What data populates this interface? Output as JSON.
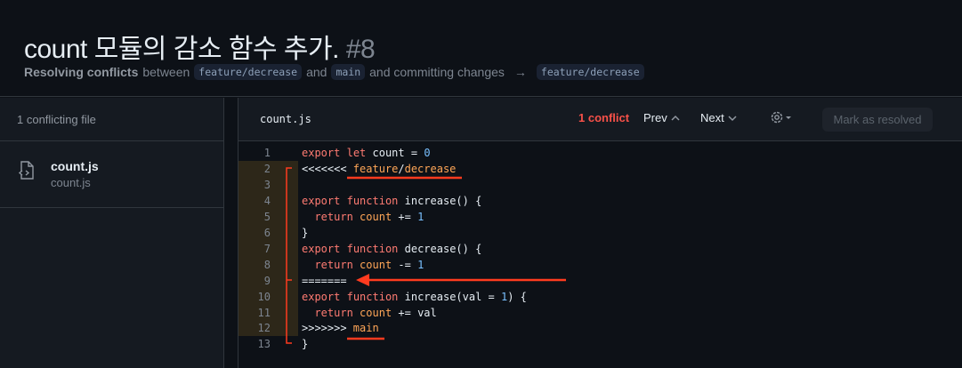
{
  "header": {
    "title": "count 모듈의 감소 함수 추가.",
    "number": "#8",
    "subtitle": {
      "bold": "Resolving conflicts",
      "t1": "between",
      "branch1": "feature/decrease",
      "t2": "and",
      "branch2": "main",
      "t3": "and committing changes",
      "arrow": "→",
      "target": "feature/decrease"
    }
  },
  "sidebar": {
    "heading": "1 conflicting file",
    "files": [
      {
        "name": "count.js",
        "path": "count.js",
        "icon": "file-code-icon"
      }
    ]
  },
  "toolbar": {
    "filename": "count.js",
    "conflicts": "1 conflict",
    "prev": "Prev",
    "next": "Next",
    "settings_icon": "gear-icon",
    "mark_resolved": "Mark as resolved"
  },
  "colors": {
    "conflict": "#f85149",
    "keyword": "#ff7b72",
    "variable": "#ffa657",
    "number": "#79c0ff",
    "annotation": "#ff3b1f"
  },
  "code": [
    {
      "n": "1",
      "conflict": false,
      "t": [
        [
          "export",
          "kw"
        ],
        [
          " ",
          "pl"
        ],
        [
          "let",
          "kw"
        ],
        [
          " count = ",
          "pl"
        ],
        [
          "0",
          "nm"
        ]
      ]
    },
    {
      "n": "2",
      "conflict": true,
      "t": [
        [
          "<<<<<<< ",
          "pl"
        ],
        [
          "feature",
          "br"
        ],
        [
          "/",
          "pl"
        ],
        [
          "decrease",
          "br"
        ]
      ]
    },
    {
      "n": "3",
      "conflict": true,
      "t": []
    },
    {
      "n": "4",
      "conflict": true,
      "t": [
        [
          "export",
          "kw"
        ],
        [
          " ",
          "pl"
        ],
        [
          "function",
          "kw"
        ],
        [
          " increase() {",
          "pl"
        ]
      ]
    },
    {
      "n": "5",
      "conflict": true,
      "t": [
        [
          "  ",
          "pl"
        ],
        [
          "return",
          "kw"
        ],
        [
          " ",
          "pl"
        ],
        [
          "count",
          "var"
        ],
        [
          " += ",
          "pl"
        ],
        [
          "1",
          "nm"
        ]
      ]
    },
    {
      "n": "6",
      "conflict": true,
      "t": [
        [
          "}",
          "pl"
        ]
      ]
    },
    {
      "n": "7",
      "conflict": true,
      "t": [
        [
          "export",
          "kw"
        ],
        [
          " ",
          "pl"
        ],
        [
          "function",
          "kw"
        ],
        [
          " decrease() {",
          "pl"
        ]
      ]
    },
    {
      "n": "8",
      "conflict": true,
      "t": [
        [
          "  ",
          "pl"
        ],
        [
          "return",
          "kw"
        ],
        [
          " ",
          "pl"
        ],
        [
          "count",
          "var"
        ],
        [
          " -= ",
          "pl"
        ],
        [
          "1",
          "nm"
        ]
      ]
    },
    {
      "n": "9",
      "conflict": true,
      "t": [
        [
          "=======",
          "pl"
        ]
      ]
    },
    {
      "n": "10",
      "conflict": true,
      "t": [
        [
          "export",
          "kw"
        ],
        [
          " ",
          "pl"
        ],
        [
          "function",
          "kw"
        ],
        [
          " increase(val = ",
          "pl"
        ],
        [
          "1",
          "nm"
        ],
        [
          ") {",
          "pl"
        ]
      ]
    },
    {
      "n": "11",
      "conflict": true,
      "t": [
        [
          "  ",
          "pl"
        ],
        [
          "return",
          "kw"
        ],
        [
          " ",
          "pl"
        ],
        [
          "count",
          "var"
        ],
        [
          " += val",
          "pl"
        ]
      ]
    },
    {
      "n": "12",
      "conflict": true,
      "t": [
        [
          ">>>>>>> ",
          "pl"
        ],
        [
          "main",
          "br"
        ]
      ]
    },
    {
      "n": "13",
      "conflict": false,
      "t": [
        [
          "}",
          "pl"
        ]
      ]
    }
  ]
}
